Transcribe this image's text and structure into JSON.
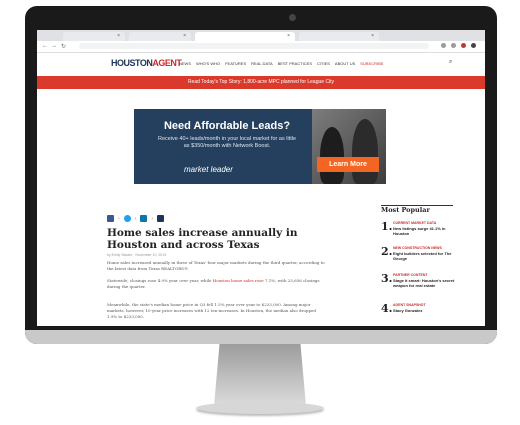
{
  "browser": {
    "tabs": [
      {
        "close": "×"
      },
      {
        "close": "×"
      },
      {
        "close": "×"
      },
      {
        "close": "×"
      }
    ],
    "nav": {
      "back": "←",
      "forward": "→",
      "reload": "↻"
    }
  },
  "site": {
    "logo_main": "HOUSTON",
    "logo_accent": "AGENT",
    "nav_items": [
      "NEWS",
      "WHO'S WHO",
      "FEATURES",
      "REAL DATA",
      "BEST PRACTICES",
      "CITIES",
      "ABOUT US"
    ],
    "nav_subscribe": "SUBSCRIBE",
    "search_icon": "⌕",
    "promo_text": "Read Today's Top Story: 1,800-acre MPC planned for League City"
  },
  "ad": {
    "title": "Need Affordable Leads?",
    "subtitle": "Receive 40+ leads/month in your local market for as little as $350/month with Network Boost.",
    "brand": "market leader",
    "cta": "Learn More"
  },
  "article": {
    "headline": "Home sales increase annually in Houston and across Texas",
    "byline": "by Emily Sabato · November 10, 2019",
    "paragraphs": [
      "Home sales increased annually in three of Texas' four major markets during the third quarter, according to the latest data from Texas REALTORS®.",
      "Statewide, closings rose 4.9% year over year, while",
      "Meanwhile, the state's median home price in Q3 fell 1.5% year over year to $233,000. Among major markets, however, 10-year price increases with 12 ten-increases. In Houston, the median also dropped 1.9% to $233,000."
    ],
    "para2_link": "Houston home sales rose",
    "para2_tail": "7.1%, with 25,656 closings during the quarter."
  },
  "sidebar": {
    "heading": "Most Popular",
    "items": [
      {
        "num": "1.",
        "category": "CURRENT MARKET DATA",
        "title": "New listings surge 41.1% in Houston"
      },
      {
        "num": "2.",
        "category": "NEW CONSTRUCTION NEWS",
        "title": "Eight builders selected for The George"
      },
      {
        "num": "3.",
        "category": "PARTNER CONTENT",
        "title": "Stage it smart: Houston's secret weapon for real estate"
      },
      {
        "num": "4.",
        "category": "AGENT SNAPSHOT",
        "title": "Stacy Gonzalez"
      }
    ]
  },
  "colors": {
    "accent": "#d93a2b",
    "brand_navy": "#1d3557",
    "ad_bg": "#24405e",
    "ad_button": "#f26522"
  }
}
